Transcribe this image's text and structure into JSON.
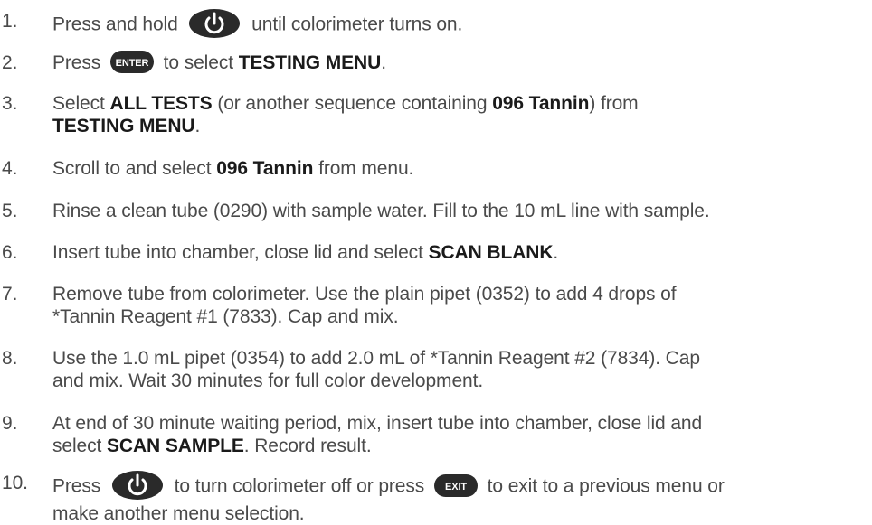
{
  "steps": [
    {
      "number": "1.",
      "text_a": "Press and hold",
      "icon": "power-icon",
      "text_b": "until colorimeter turns on."
    },
    {
      "number": "2.",
      "text_a": "Press",
      "icon_label": "ENTER",
      "text_b": "to select",
      "bold_a": "TESTING MENU",
      "text_c": "."
    },
    {
      "number": "3.",
      "text_a": "Select",
      "bold_a": "ALL TESTS",
      "text_b": "(or another sequence containing",
      "bold_b": "096 Tannin",
      "text_c": ") from",
      "bold_c": "TESTING MENU",
      "text_d": "."
    },
    {
      "number": "4.",
      "text_a": "Scroll to and select",
      "bold_a": "096 Tannin",
      "text_b": "from menu."
    },
    {
      "number": "5.",
      "text_a": "Rinse a clean tube (0290) with sample water. Fill to the 10 mL line with sample."
    },
    {
      "number": "6.",
      "text_a": "Insert tube into chamber, close lid and select",
      "bold_a": "SCAN BLANK",
      "text_b": "."
    },
    {
      "number": "7.",
      "line1": "Remove tube from colorimeter. Use the plain pipet (0352) to add 4 drops of",
      "line2": "*Tannin Reagent #1 (7833). Cap and mix."
    },
    {
      "number": "8.",
      "line1": "Use the 1.0 mL pipet (0354) to add 2.0 mL of *Tannin Reagent #2 (7834). Cap",
      "line2": "and mix. Wait 30 minutes for full color development."
    },
    {
      "number": "9.",
      "line1": "At end of 30 minute waiting period, mix, insert tube into chamber, close lid and",
      "text_a": "select",
      "bold_a": "SCAN SAMPLE",
      "text_b": ". Record result."
    },
    {
      "number": "10.",
      "text_a": "Press",
      "icon": "power-icon",
      "text_b": "to turn colorimeter off or press",
      "icon_label": "EXIT",
      "text_c": "to exit to a previous menu or",
      "line2": "make another menu selection."
    }
  ],
  "colors": {
    "text": "#4a4a4a",
    "bold_text": "#1a1a1a",
    "icon_fill": "#2a2a2a",
    "icon_glyph": "#ffffff"
  }
}
